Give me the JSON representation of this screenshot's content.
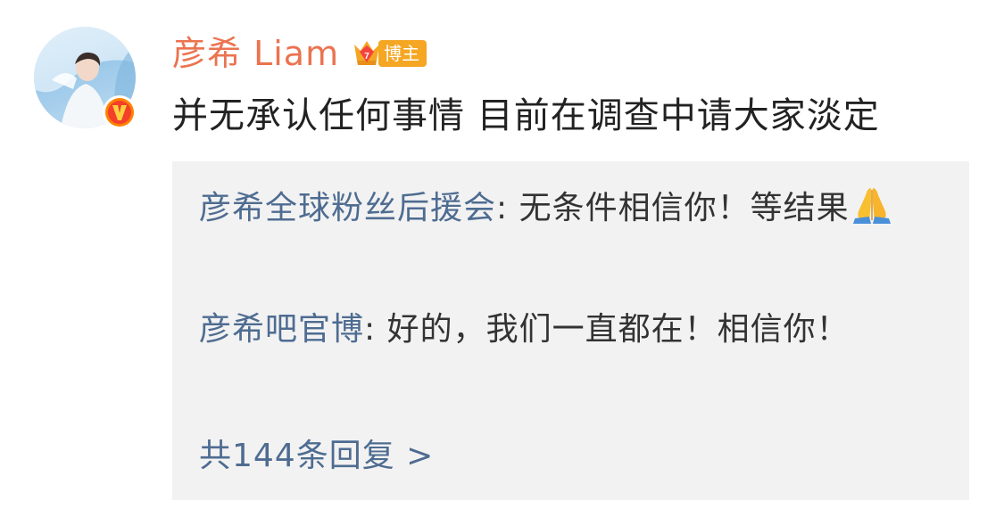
{
  "post": {
    "author": {
      "name": "彦希 Liam",
      "badge_label": "博主",
      "avatar_icon": "avatar-photo",
      "verified_icon": "verified-v-icon"
    },
    "text": "并无承认任何事情 目前在调查中请大家淡定"
  },
  "comments": [
    {
      "author": "彦希全球粉丝后援会",
      "separator": ": ",
      "text": "无条件相信你！等结果",
      "emoji": "folded-hands-icon"
    },
    {
      "author": "彦希吧官博",
      "separator": ": ",
      "text": "好的，我们一直都在！相信你！"
    }
  ],
  "more_replies": {
    "label": "共144条回复 >"
  },
  "colors": {
    "username": "#eb7350",
    "link_blue": "#4e6c91",
    "comment_bg": "#f2f2f2",
    "badge_orange": "#f5a623",
    "verified_orange": "#ff8200"
  }
}
